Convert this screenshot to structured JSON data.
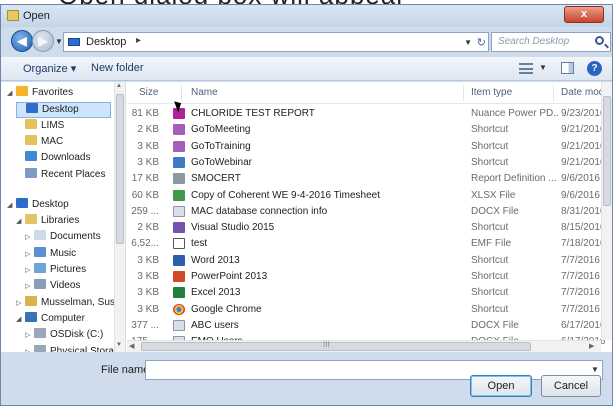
{
  "window": {
    "title": "Open",
    "close_label": "x"
  },
  "nav": {
    "back_glyph": "◀",
    "forward_glyph": "▶"
  },
  "address": {
    "location": "Desktop",
    "separator": "▸",
    "search_placeholder": "Search Desktop"
  },
  "toolbar": {
    "organize_label": "Organize ▾",
    "new_folder_label": "New folder",
    "help_label": "?"
  },
  "sidebar": {
    "items": [
      {
        "label": "Favorites",
        "icon": "star-icon",
        "indent": 0,
        "expander": "◢"
      },
      {
        "label": "Desktop",
        "icon": "desktop-icon",
        "indent": 1,
        "selected": true
      },
      {
        "label": "LIMS",
        "icon": "folder-icon",
        "indent": 1
      },
      {
        "label": "MAC",
        "icon": "folder-icon",
        "indent": 1
      },
      {
        "label": "Downloads",
        "icon": "downloads-icon",
        "indent": 1
      },
      {
        "label": "Recent Places",
        "icon": "recent-places-icon",
        "indent": 1
      },
      {
        "label": "Desktop",
        "icon": "desktop-icon",
        "indent": 0,
        "expander": "◢"
      },
      {
        "label": "Libraries",
        "icon": "libraries-icon",
        "indent": 1,
        "expander": "◢"
      },
      {
        "label": "Documents",
        "icon": "documents-icon",
        "indent": 2,
        "expander": "▷"
      },
      {
        "label": "Music",
        "icon": "music-icon",
        "indent": 2,
        "expander": "▷"
      },
      {
        "label": "Pictures",
        "icon": "pictures-icon",
        "indent": 2,
        "expander": "▷"
      },
      {
        "label": "Videos",
        "icon": "videos-icon",
        "indent": 2,
        "expander": "▷"
      },
      {
        "label": "Musselman, Susa",
        "icon": "user-folder-icon",
        "indent": 1,
        "expander": "▷"
      },
      {
        "label": "Computer",
        "icon": "computer-icon",
        "indent": 1,
        "expander": "◢"
      },
      {
        "label": "OSDisk (C:)",
        "icon": "drive-icon",
        "indent": 2,
        "expander": "▷"
      },
      {
        "label": "Physical Stora...",
        "icon": "drive-icon",
        "indent": 2,
        "expander": "▷"
      }
    ]
  },
  "columns": {
    "size": "Size",
    "name": "Name",
    "type": "Item type",
    "date": "Date mod"
  },
  "files": [
    {
      "size": "81 KB",
      "name": "CHLORIDE TEST REPORT",
      "type": "Nuance Power PD...",
      "date": "9/23/2016",
      "icon": "pdf"
    },
    {
      "size": "2 KB",
      "name": "GoToMeeting",
      "type": "Shortcut",
      "date": "9/21/2016",
      "icon": "goto"
    },
    {
      "size": "3 KB",
      "name": "GoToTraining",
      "type": "Shortcut",
      "date": "9/21/2016",
      "icon": "goto"
    },
    {
      "size": "3 KB",
      "name": "GoToWebinar",
      "type": "Shortcut",
      "date": "9/21/2016",
      "icon": "gotob"
    },
    {
      "size": "17 KB",
      "name": "SMOCERT",
      "type": "Report Definition ...",
      "date": "9/6/2016",
      "icon": "rpt"
    },
    {
      "size": "60 KB",
      "name": "Copy of Coherent WE 9-4-2016 Timesheet",
      "type": "XLSX File",
      "date": "9/6/2016",
      "icon": "xls"
    },
    {
      "size": "259 ...",
      "name": "MAC database connection info",
      "type": "DOCX File",
      "date": "8/31/2016",
      "icon": "doc"
    },
    {
      "size": "2 KB",
      "name": "Visual Studio 2015",
      "type": "Shortcut",
      "date": "8/15/2016",
      "icon": "vs"
    },
    {
      "size": "6,52...",
      "name": "test",
      "type": "EMF File",
      "date": "7/18/2016",
      "icon": "emf"
    },
    {
      "size": "3 KB",
      "name": "Word 2013",
      "type": "Shortcut",
      "date": "7/7/2016",
      "icon": "word"
    },
    {
      "size": "3 KB",
      "name": "PowerPoint 2013",
      "type": "Shortcut",
      "date": "7/7/2016",
      "icon": "ppt"
    },
    {
      "size": "3 KB",
      "name": "Excel 2013",
      "type": "Shortcut",
      "date": "7/7/2016",
      "icon": "excel"
    },
    {
      "size": "3 KB",
      "name": "Google Chrome",
      "type": "Shortcut",
      "date": "7/7/2016",
      "icon": "chrome"
    },
    {
      "size": "377 ...",
      "name": "ABC users",
      "type": "DOCX File",
      "date": "6/17/2016",
      "icon": "doc"
    },
    {
      "size": "175 ...",
      "name": "EMO Users",
      "type": "DOCX File",
      "date": "6/17/2016",
      "icon": "doc"
    }
  ],
  "scroll": {
    "grip": "III"
  },
  "bottom": {
    "file_name_label": "File name:",
    "file_name_value": "",
    "open_label": "Open",
    "cancel_label": "Cancel"
  },
  "caption_fragment": "Open dialog box will appear"
}
